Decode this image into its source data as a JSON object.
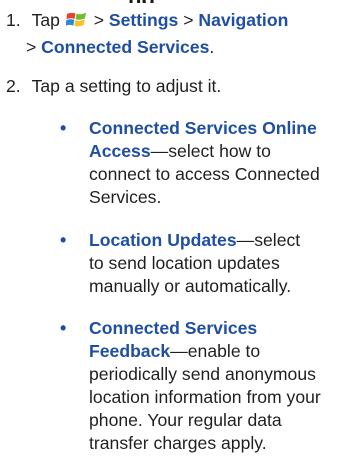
{
  "heading_fragment": "ng",
  "steps": [
    {
      "number": "1.",
      "tap": "Tap",
      "gt1": ">",
      "settings": "Settings",
      "gt2": ">",
      "navigation": "Navigation",
      "gt3": ">",
      "connected_services": "Connected Services",
      "period": "."
    },
    {
      "number": "2.",
      "text": "Tap a setting to adjust it."
    }
  ],
  "bullets": [
    {
      "symbol": "•",
      "title_line1": "Connected Services Online",
      "title_line2": "Access",
      "desc_line2": "—select how to",
      "desc_line3": "connect to access Connected",
      "desc_line4": "Services."
    },
    {
      "symbol": "•",
      "title": "Location Updates",
      "desc_line1": "—select",
      "desc_line2": "to send location updates",
      "desc_line3": "manually or automatically."
    },
    {
      "symbol": "•",
      "title_line1": "Connected Services",
      "title_line2": "Feedback",
      "desc_line2": "—enable to",
      "desc_line3": "periodically send anonymous",
      "desc_line4": "location information from your",
      "desc_line5": "phone. Your regular data",
      "desc_line6": "transfer charges apply."
    }
  ],
  "icons": {
    "start_icon": "windows-start-logo",
    "colors": {
      "red": "#e8432c",
      "green": "#6bbf2e",
      "blue": "#2c87d8",
      "yellow": "#f6c22a"
    }
  },
  "colors": {
    "link_blue": "#1f4fa3",
    "text": "#1f1f1f"
  }
}
